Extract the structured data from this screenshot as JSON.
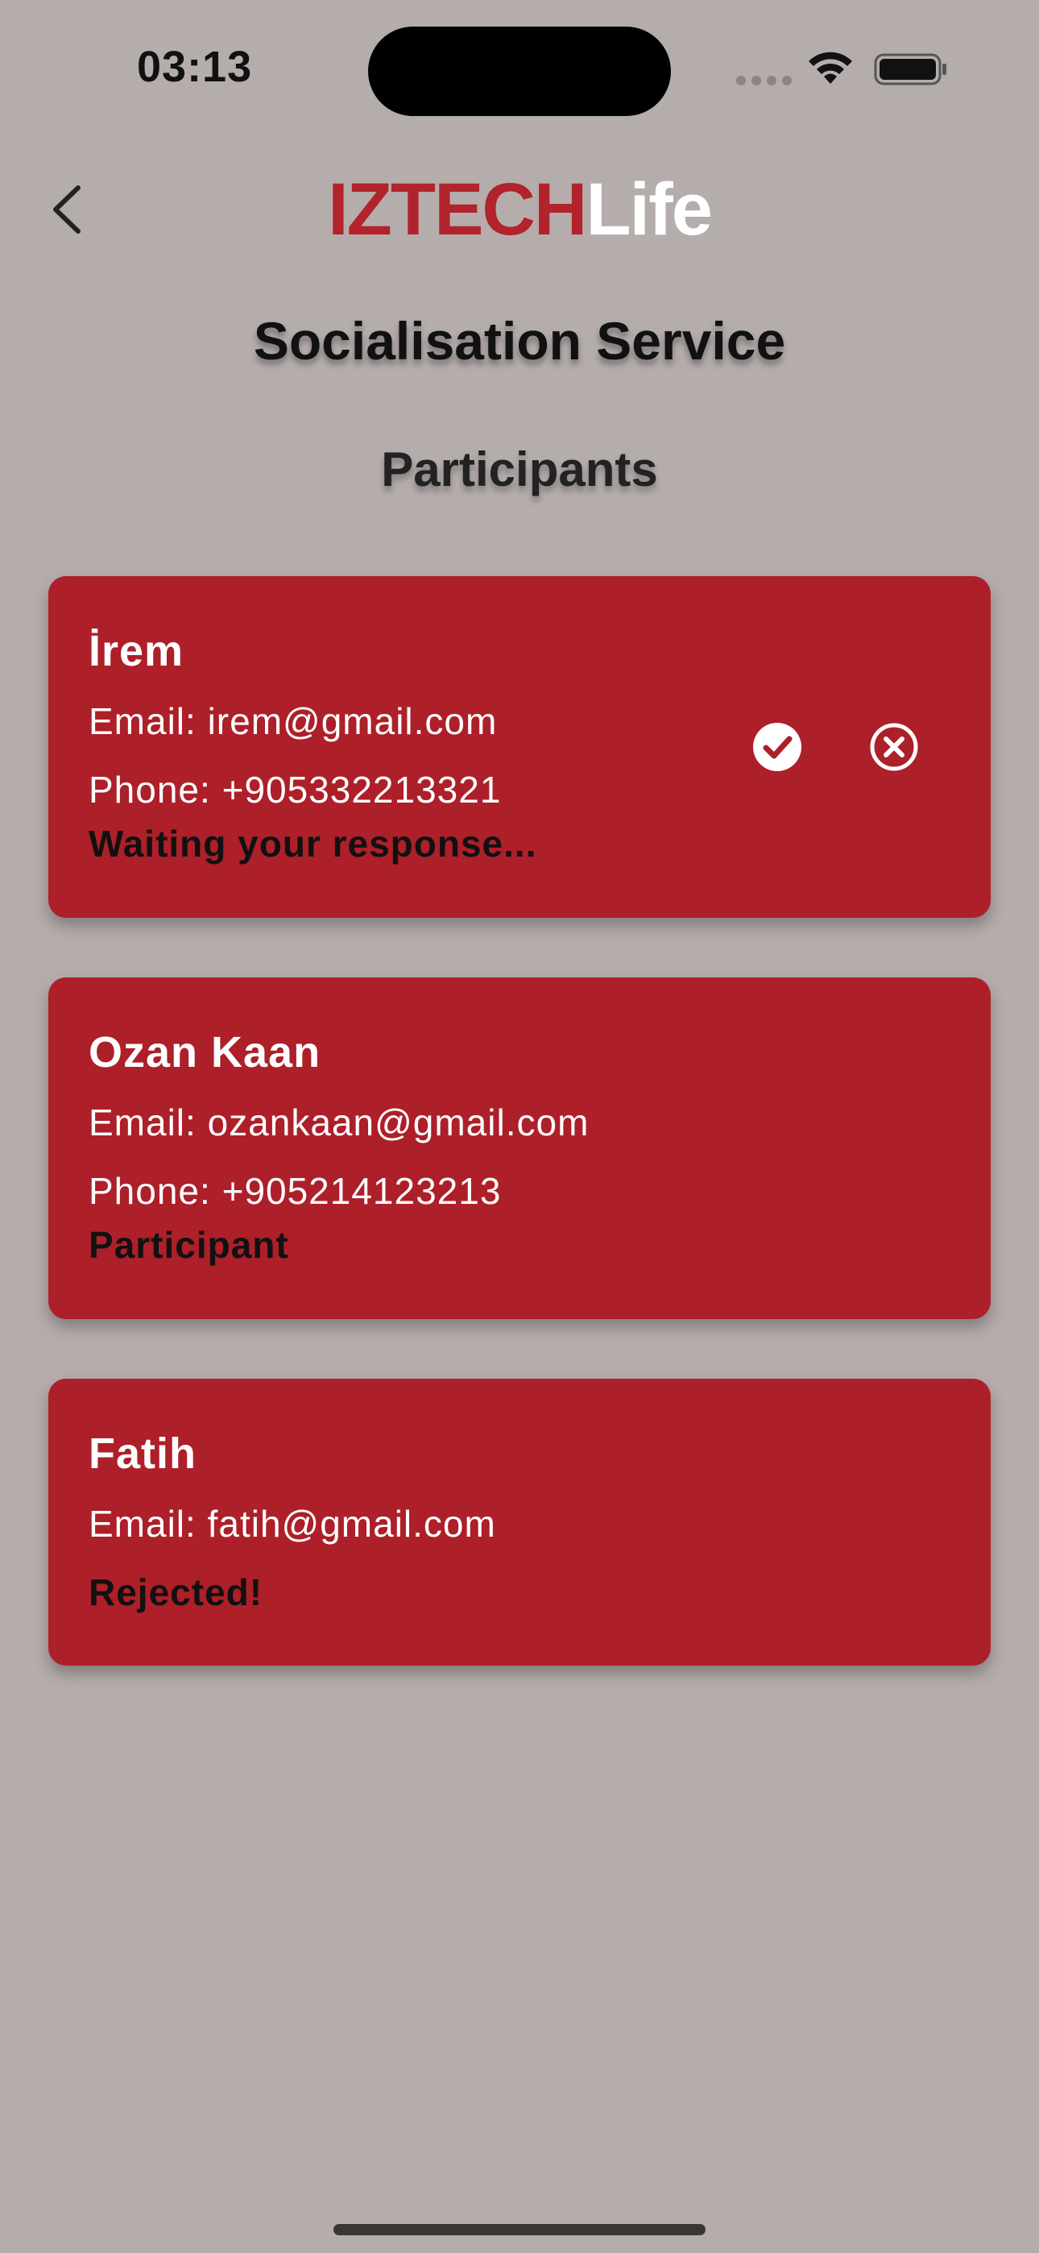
{
  "status_bar": {
    "time": "03:13"
  },
  "header": {
    "logo_part1": "IZTECH",
    "logo_part2": "Life",
    "back_icon": "chevron-left-icon"
  },
  "page": {
    "title": "Socialisation Service",
    "section_title": "Participants"
  },
  "participants": [
    {
      "name": "İrem",
      "email": "Email: irem@gmail.com",
      "phone": "Phone: +905332213321",
      "status": "Waiting your response...",
      "actions": [
        "accept-check-icon",
        "reject-x-icon"
      ]
    },
    {
      "name": "Ozan Kaan",
      "email": "Email: ozankaan@gmail.com",
      "phone": "Phone: +905214123213",
      "status": "Participant"
    },
    {
      "name": "Fatih",
      "email": "Email: fatih@gmail.com",
      "status": "Rejected!"
    }
  ],
  "colors": {
    "background": "#b5adac",
    "card": "#ad1f29",
    "brand_red": "#b2232b"
  }
}
